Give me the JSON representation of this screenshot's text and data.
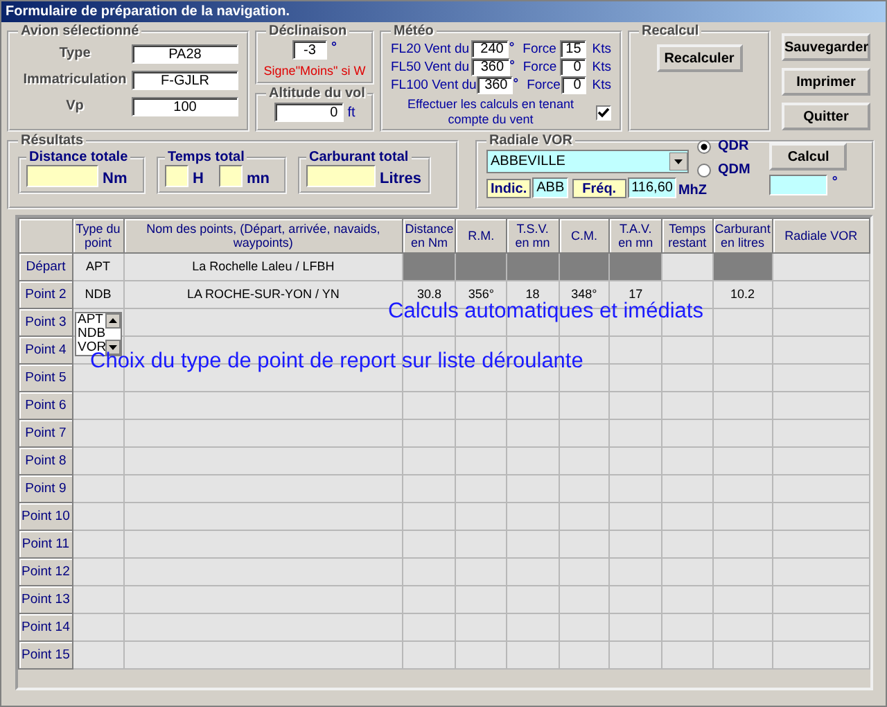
{
  "window": {
    "title": "Formulaire de préparation de la navigation."
  },
  "aircraft": {
    "title": "Avion sélectionné",
    "fields": [
      {
        "label": "Type",
        "value": "PA28"
      },
      {
        "label": "Immatriculation",
        "value": "F-GJLR"
      },
      {
        "label": "Vp",
        "value": "100"
      }
    ]
  },
  "declination": {
    "title": "Déclinaison",
    "value": "-3",
    "unit": "°",
    "note": "Signe\"Moins\" si W"
  },
  "altitude": {
    "title": "Altitude du vol",
    "value": "0",
    "unit": "ft"
  },
  "weather": {
    "title": "Météo",
    "levels": [
      {
        "label": "FL20 Vent du",
        "direction": "240",
        "unit": "°",
        "force_label": "Force",
        "force": "15",
        "force_unit": "Kts"
      },
      {
        "label": "FL50 Vent du",
        "direction": "360",
        "unit": "°",
        "force_label": "Force",
        "force": "0",
        "force_unit": "Kts"
      },
      {
        "label": "FL100 Vent du",
        "direction": "360",
        "unit": "°",
        "force_label": "Force",
        "force": "0",
        "force_unit": "Kts"
      }
    ],
    "wind_option": {
      "label": "Effectuer les calculs en tenant compte du vent",
      "checked": true
    }
  },
  "recalc": {
    "title": "Recalcul",
    "button": "Recalculer"
  },
  "actions": [
    "Sauvegarder",
    "Imprimer",
    "Quitter"
  ],
  "results": {
    "title": "Résultats",
    "distance": {
      "title": "Distance totale",
      "unit": "Nm"
    },
    "time": {
      "title": "Temps total",
      "hours_unit": "H",
      "minutes_unit": "mn"
    },
    "fuel": {
      "title": "Carburant total",
      "unit": "Litres"
    }
  },
  "vor": {
    "title": "Radiale VOR",
    "station": "ABBEVILLE",
    "ident_label": "Indic.",
    "ident": "ABB",
    "freq_label": "Fréq.",
    "freq": "116,60",
    "freq_unit": "MhZ",
    "modes": [
      {
        "label": "QDR",
        "selected": true
      },
      {
        "label": "QDM",
        "selected": false
      }
    ],
    "button": "Calcul",
    "result_unit": "°"
  },
  "table": {
    "columns": [
      "Type du point",
      "Nom des points, (Départ, arrivée, navaids, waypoints)",
      "Distance en Nm",
      "R.M.",
      "T.S.V. en mn",
      "C.M.",
      "T.A.V. en mn",
      "Temps restant",
      "Carburant en litres",
      "Radiale VOR"
    ],
    "rows": [
      {
        "header": "Départ",
        "disabled": true,
        "type": "APT",
        "name": "La Rochelle Laleu / LFBH"
      },
      {
        "header": "Point 2",
        "disabled": false,
        "type": "NDB",
        "name": "LA ROCHE-SUR-YON / YN",
        "distance": "30.8",
        "rm": "356°",
        "tsv": "18",
        "cm": "348°",
        "tav": "17",
        "fuel": "10.2"
      },
      {
        "header": "Point 3",
        "disabled": false
      },
      {
        "header": "Point 4",
        "disabled": false
      },
      {
        "header": "Point 5",
        "disabled": false
      },
      {
        "header": "Point 6",
        "disabled": false
      },
      {
        "header": "Point 7",
        "disabled": false
      },
      {
        "header": "Point 8",
        "disabled": false
      },
      {
        "header": "Point 9",
        "disabled": false
      },
      {
        "header": "Point 10",
        "disabled": false
      },
      {
        "header": "Point 11",
        "disabled": false
      },
      {
        "header": "Point 12",
        "disabled": false
      },
      {
        "header": "Point 13",
        "disabled": false
      },
      {
        "header": "Point 14",
        "disabled": false
      },
      {
        "header": "Point 15",
        "disabled": false
      }
    ]
  },
  "type_list": {
    "options": [
      "APT",
      "NDB",
      "VOR"
    ]
  },
  "annotations": [
    "Calculs automatiques et imédiats",
    "Choix du type de point de report sur liste déroulante"
  ]
}
